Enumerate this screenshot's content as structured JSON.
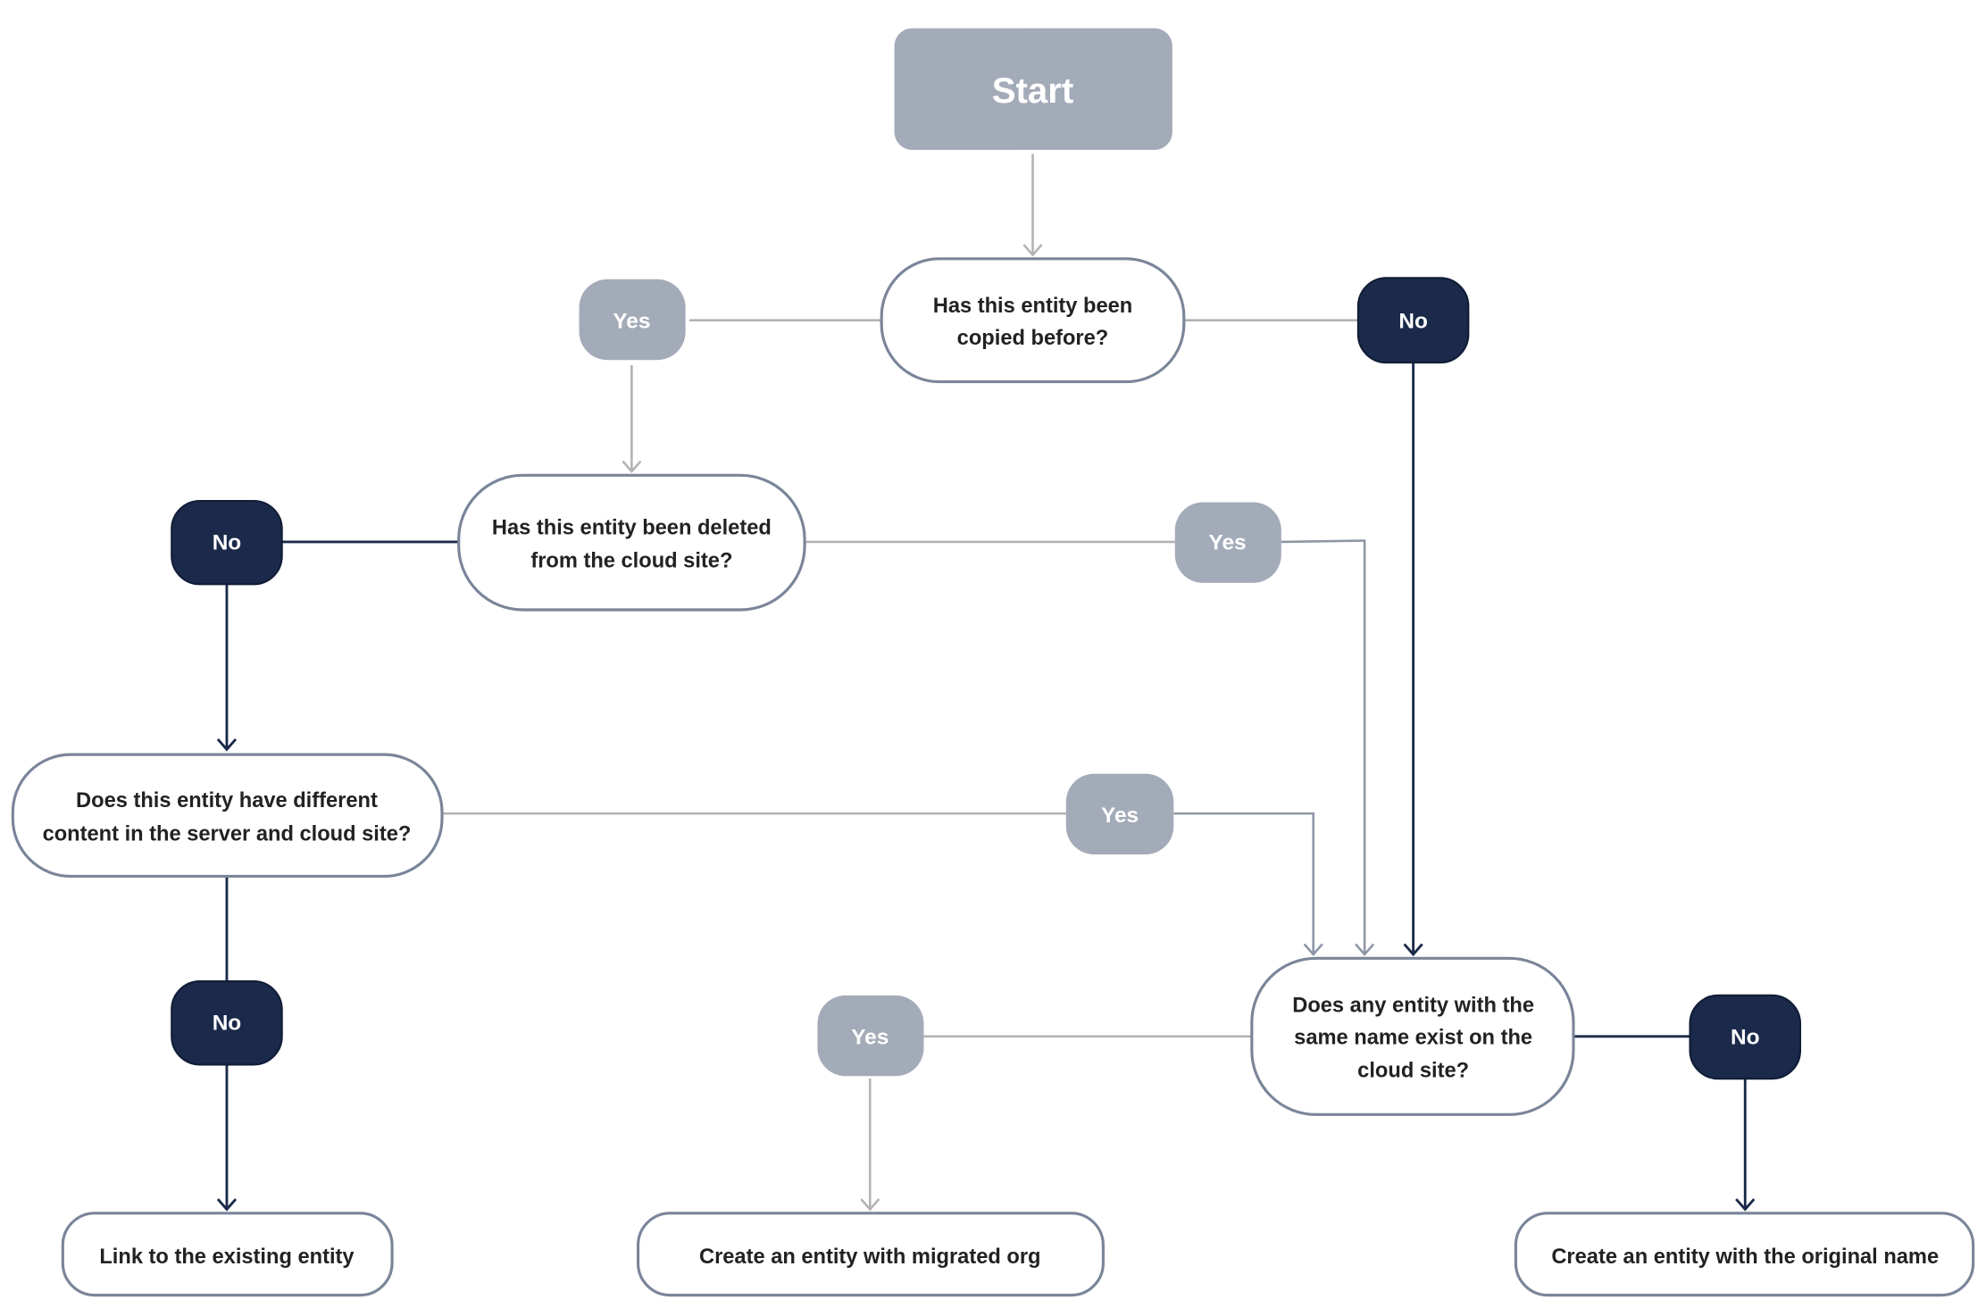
{
  "colors": {
    "start_fill": "#a4abb8",
    "yes_fill": "#a4abb8",
    "no_fill": "#1b2a4a",
    "question_border": "#7a8599",
    "connector_gray": "#b3b3b3",
    "connector_navy": "#1b2a4a"
  },
  "start": {
    "label": "Start"
  },
  "questions": [
    {
      "lines": [
        "Has this entity been",
        "copied before?"
      ]
    },
    {
      "lines": [
        "Has this entity been deleted",
        "from the cloud site?"
      ]
    },
    {
      "lines": [
        "Does this entity have different",
        "content in the server and cloud site?"
      ]
    },
    {
      "lines": [
        "Does any entity with the",
        "same name exist on the",
        "cloud site?"
      ]
    }
  ],
  "answers": {
    "yes": "Yes",
    "no": "No"
  },
  "outcomes": [
    {
      "label": "Link to the existing entity"
    },
    {
      "label": "Create an entity with migrated org"
    },
    {
      "label": "Create an entity with the original name"
    }
  ]
}
